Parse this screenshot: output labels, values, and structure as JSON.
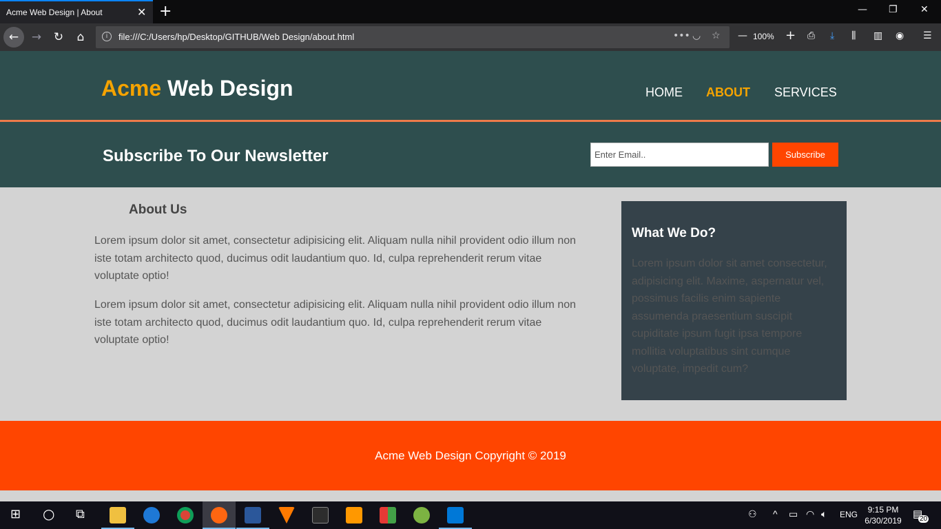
{
  "browser": {
    "tab_title": "Acme Web Design | About",
    "url": "file:///C:/Users/hp/Desktop/GITHUB/Web Design/about.html",
    "zoom": "100%"
  },
  "site": {
    "logo_highlight": "Acme",
    "logo_rest": " Web Design",
    "nav": [
      "HOME",
      "ABOUT",
      "SERVICES"
    ],
    "active_nav": "ABOUT",
    "colors": {
      "header_bg": "#2e4e4e",
      "accent": "#f5a300",
      "button": "#ff4500",
      "sidebar_bg": "#35424a"
    }
  },
  "newsletter": {
    "heading": "Subscribe To Our Newsletter",
    "email_placeholder": "Enter Email..",
    "button_label": "Subscribe"
  },
  "main": {
    "heading": "About Us",
    "paragraphs": [
      "Lorem ipsum dolor sit amet, consectetur adipisicing elit. Aliquam nulla nihil provident odio illum non iste totam architecto quod, ducimus odit laudantium quo. Id, culpa reprehenderit rerum vitae voluptate optio!",
      "Lorem ipsum dolor sit amet, consectetur adipisicing elit. Aliquam nulla nihil provident odio illum non iste totam architecto quod, ducimus odit laudantium quo. Id, culpa reprehenderit rerum vitae voluptate optio!"
    ]
  },
  "sidebar": {
    "heading": "What We Do?",
    "text": "Lorem ipsum dolor sit amet consectetur, adipisicing elit. Maxime, aspernatur vel, possimus facilis enim sapiente assumenda praesentium suscipit cupiditate ipsum fugit ipsa tempore mollitia voluptatibus sint cumque voluptate, impedit cum?"
  },
  "footer": {
    "copyright": "Acme Web Design Copyright © 2019"
  },
  "taskbar": {
    "language": "ENG",
    "time": "9:15 PM",
    "date": "6/30/2019",
    "notifications": "20"
  }
}
